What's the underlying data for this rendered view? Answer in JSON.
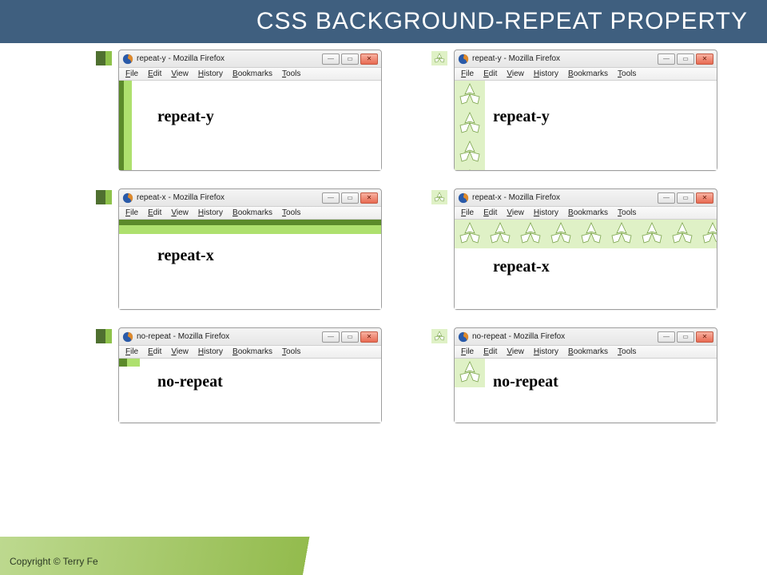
{
  "slide": {
    "title": "CSS BACKGROUND-REPEAT PROPERTY",
    "copyright": "Copyright © Terry Fe"
  },
  "browser": {
    "menu": [
      "File",
      "Edit",
      "View",
      "History",
      "Bookmarks",
      "Tools"
    ],
    "win_minimize": "—",
    "win_maximize": "▭",
    "win_close": "✕",
    "title_suffix": " - Mozilla Firefox"
  },
  "examples": [
    {
      "value": "repeat-y",
      "title": "repeat-y - Mozilla Firefox",
      "label": "repeat-y"
    },
    {
      "value": "repeat-x",
      "title": "repeat-x - Mozilla Firefox",
      "label": "repeat-x"
    },
    {
      "value": "no-repeat",
      "title": "no-repeat - Mozilla Firefox",
      "label": "no-repeat"
    }
  ],
  "icons": {
    "firefox": "firefox-icon",
    "flower": "trillium-icon"
  },
  "colors": {
    "header": "#3f5f7f",
    "accent_dark": "#5b8a2a",
    "accent_light": "#aee06e",
    "tile_bg": "#dff1c6"
  }
}
